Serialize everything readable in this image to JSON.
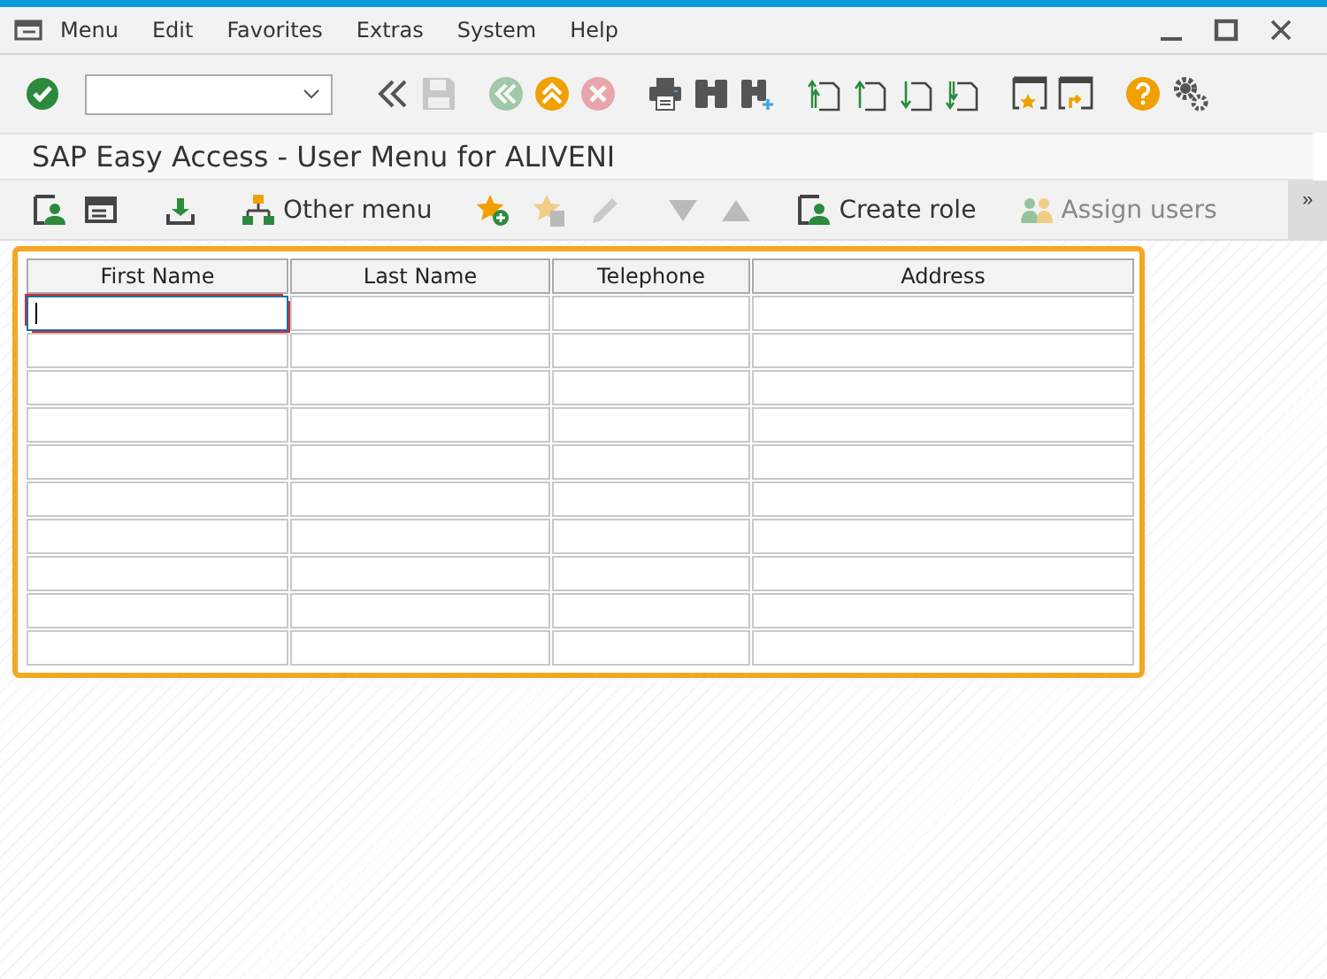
{
  "menu_bar": [
    {
      "label": "Menu"
    },
    {
      "label": "Edit"
    },
    {
      "label": "Favorites"
    },
    {
      "label": "Extras"
    },
    {
      "label": "System"
    },
    {
      "label": "Help"
    }
  ],
  "toolbar": [
    {
      "kind": "enter",
      "disabled": false
    },
    {
      "kind": "command-field"
    },
    {
      "kind": "collapse",
      "disabled": false
    },
    {
      "kind": "save",
      "disabled": true
    },
    {
      "kind": "back",
      "disabled": true
    },
    {
      "kind": "exit",
      "disabled": false
    },
    {
      "kind": "cancel",
      "disabled": true
    },
    {
      "kind": "print",
      "disabled": false
    },
    {
      "kind": "find",
      "disabled": false
    },
    {
      "kind": "find-next",
      "disabled": false
    },
    {
      "kind": "first-page",
      "disabled": false
    },
    {
      "kind": "previous-page",
      "disabled": false
    },
    {
      "kind": "next-page",
      "disabled": false
    },
    {
      "kind": "last-page",
      "disabled": false
    },
    {
      "kind": "new-session",
      "disabled": false
    },
    {
      "kind": "shortcut",
      "disabled": false
    },
    {
      "kind": "help",
      "disabled": false
    },
    {
      "kind": "settings",
      "disabled": false
    }
  ],
  "screen_title": "SAP Easy Access  -  User Menu for ALIVENI",
  "app_toolbar": [
    {
      "kind": "user-menu",
      "disabled": false
    },
    {
      "kind": "sap-menu",
      "disabled": false
    },
    {
      "kind": "workplace",
      "disabled": false
    },
    {
      "kind": "other-menu",
      "label": "Other menu",
      "disabled": false
    },
    {
      "kind": "add-favorite",
      "disabled": false
    },
    {
      "kind": "delete-favorite",
      "disabled": true
    },
    {
      "kind": "edit",
      "disabled": true
    },
    {
      "kind": "move-down",
      "disabled": true
    },
    {
      "kind": "move-up",
      "disabled": true
    },
    {
      "kind": "create-role",
      "label": "Create role",
      "disabled": false
    },
    {
      "kind": "assign-users",
      "label": "Assign users",
      "disabled": true
    }
  ],
  "overflow": "»",
  "table": {
    "columns": [
      "First Name",
      "Last Name",
      "Telephone",
      "Address"
    ],
    "rows": [
      {
        "cells": [
          {
            "selected": true
          },
          {
            "selected": false
          },
          {
            "selected": false
          },
          {
            "selected": false
          }
        ]
      },
      {
        "cells": [
          {
            "selected": false
          },
          {
            "selected": false
          },
          {
            "selected": false
          },
          {
            "selected": false
          }
        ]
      },
      {
        "cells": [
          {
            "selected": false
          },
          {
            "selected": false
          },
          {
            "selected": false
          },
          {
            "selected": false
          }
        ]
      },
      {
        "cells": [
          {
            "selected": false
          },
          {
            "selected": false
          },
          {
            "selected": false
          },
          {
            "selected": false
          }
        ]
      },
      {
        "cells": [
          {
            "selected": false
          },
          {
            "selected": false
          },
          {
            "selected": false
          },
          {
            "selected": false
          }
        ]
      },
      {
        "cells": [
          {
            "selected": false
          },
          {
            "selected": false
          },
          {
            "selected": false
          },
          {
            "selected": false
          }
        ]
      },
      {
        "cells": [
          {
            "selected": false
          },
          {
            "selected": false
          },
          {
            "selected": false
          },
          {
            "selected": false
          }
        ]
      },
      {
        "cells": [
          {
            "selected": false
          },
          {
            "selected": false
          },
          {
            "selected": false
          },
          {
            "selected": false
          }
        ]
      },
      {
        "cells": [
          {
            "selected": false
          },
          {
            "selected": false
          },
          {
            "selected": false
          },
          {
            "selected": false
          }
        ]
      },
      {
        "cells": [
          {
            "selected": false
          },
          {
            "selected": false
          },
          {
            "selected": false
          },
          {
            "selected": false
          }
        ]
      }
    ]
  }
}
